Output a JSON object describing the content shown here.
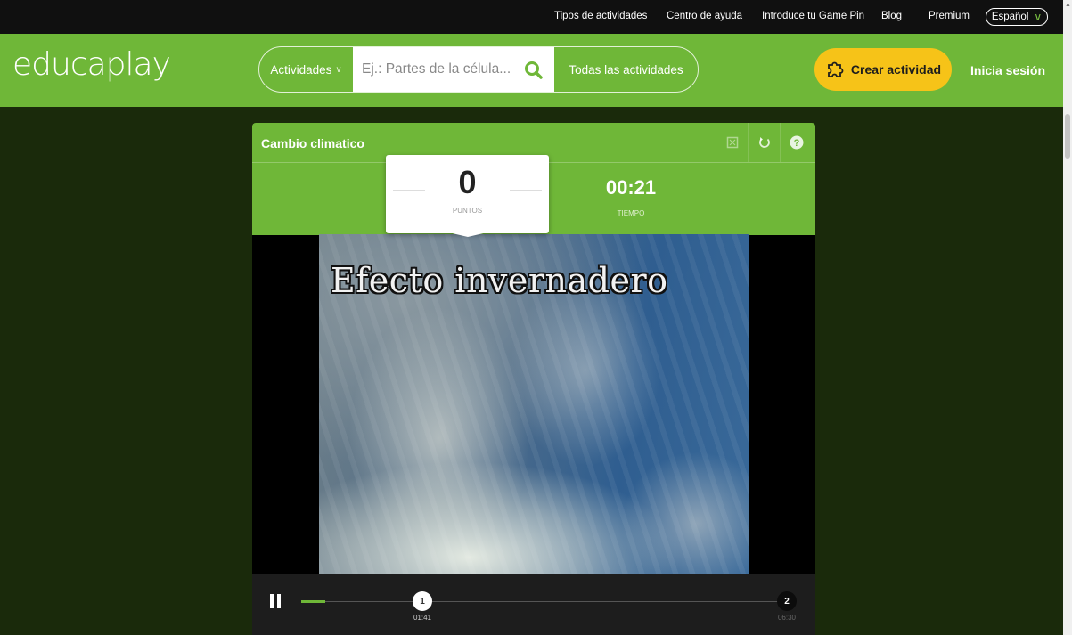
{
  "topbar": {
    "links": [
      "Tipos de actividades",
      "Centro de ayuda",
      "Introduce tu Game Pin",
      "Blog",
      "Premium"
    ],
    "language": "Español"
  },
  "header": {
    "logo": "educaplay",
    "search_category": "Actividades",
    "search_placeholder": "Ej.: Partes de la célula...",
    "all_activities": "Todas las actividades",
    "create": "Crear actividad",
    "login": "Inicia sesión"
  },
  "activity": {
    "title": "Cambio climatico",
    "score": "0",
    "score_label": "PUNTOS",
    "time": "00:21",
    "time_label": "TIEMPO",
    "video_caption": "Efecto invernadero"
  },
  "player": {
    "progress_fraction": 0.05,
    "markers": [
      {
        "number": "1",
        "time": "01:41",
        "position_fraction": 0.25
      },
      {
        "number": "2",
        "time": "06:30",
        "position_fraction": 1.0
      }
    ]
  },
  "colors": {
    "brand_green": "#6fb738",
    "create_yellow": "#f6c318",
    "page_bg": "#1a2a0b"
  },
  "icons": {
    "fullscreen": "fullscreen-icon",
    "restart": "restart-icon",
    "help": "help-icon",
    "search": "search-icon",
    "create": "puzzle-icon",
    "pause": "pause-icon"
  }
}
